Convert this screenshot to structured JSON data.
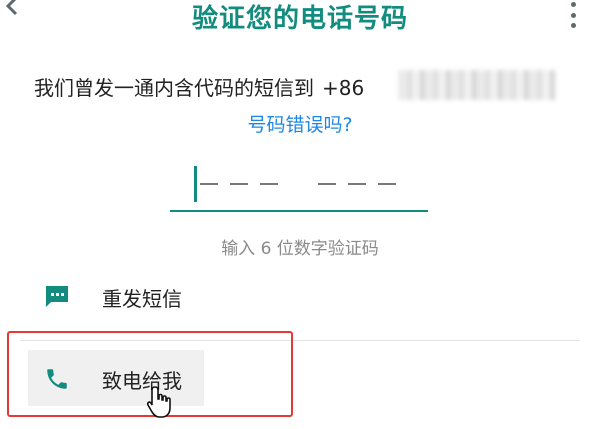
{
  "header": {
    "title": "验证您的电话号码"
  },
  "message": {
    "text": "我们曾发一通内含代码的短信到",
    "country_code": "+86"
  },
  "wrong_number_link": "号码错误吗?",
  "code_input": {
    "digit_count": 6,
    "hint": "输入 6 位数字验证码"
  },
  "options": {
    "resend_sms": "重发短信",
    "call_me": "致电给我"
  },
  "colors": {
    "accent": "#128C7E",
    "link": "#1e88e5",
    "highlight_box": "#e53935"
  }
}
